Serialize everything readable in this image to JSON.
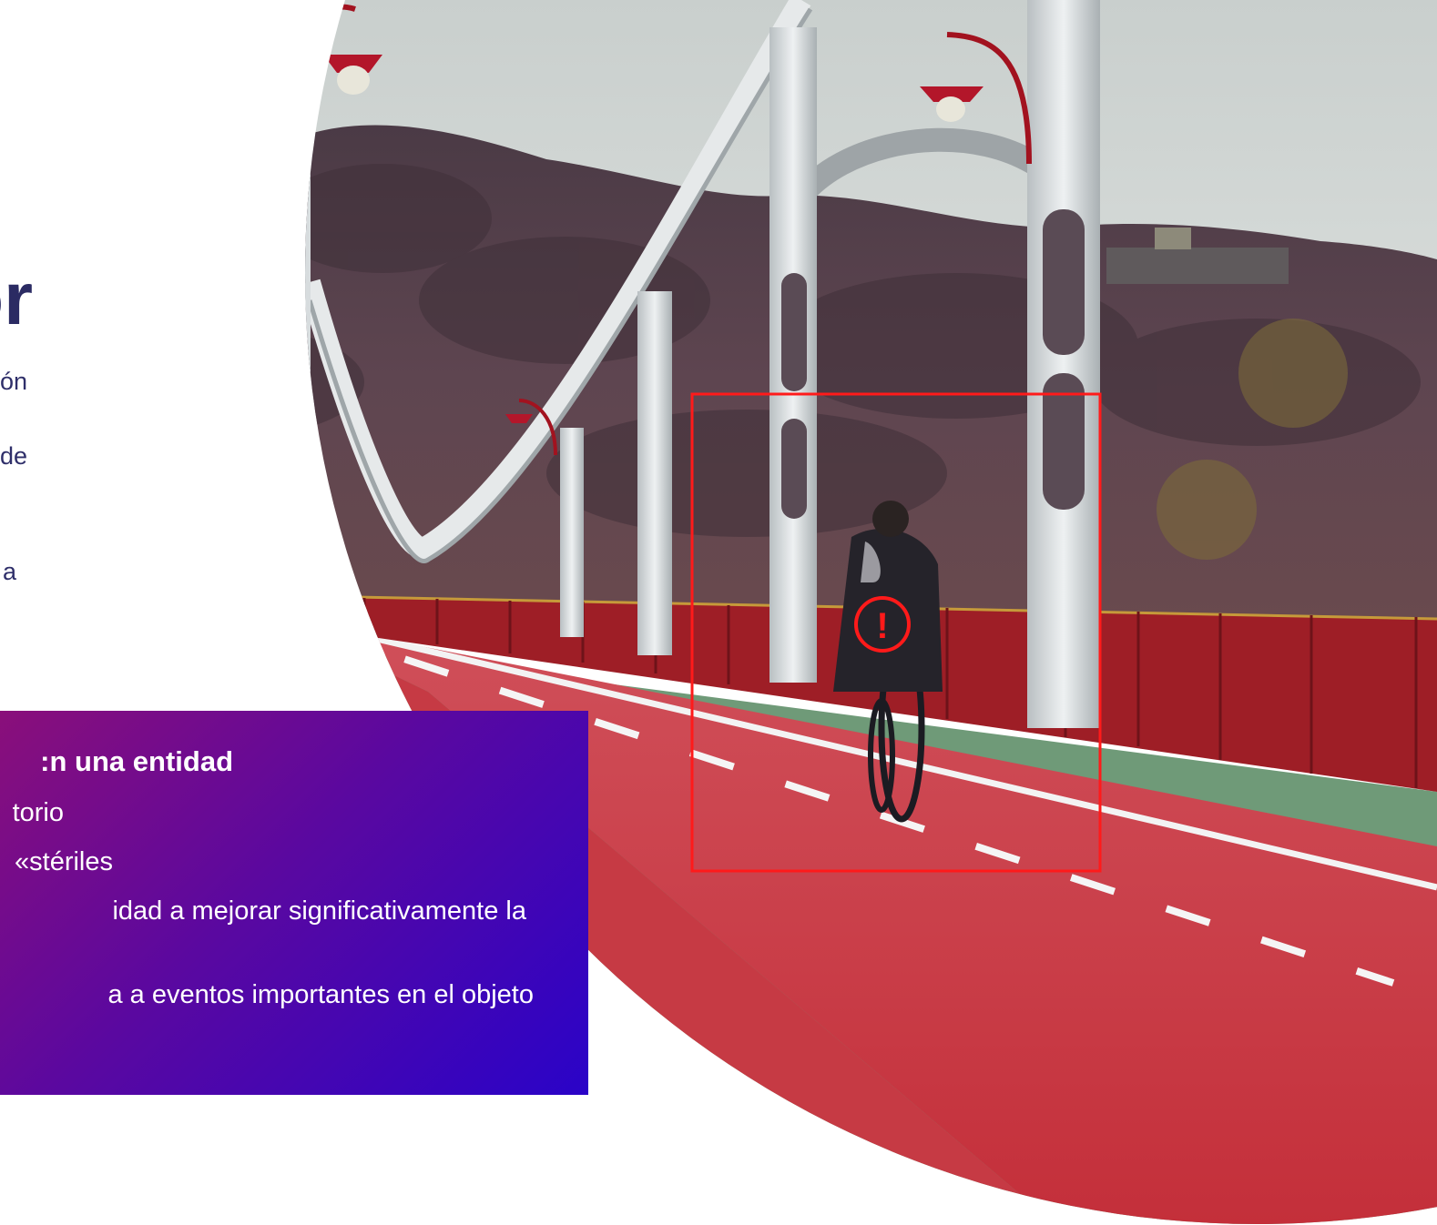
{
  "heading": "or",
  "left_fragments": [
    "ón",
    "de",
    "a"
  ],
  "gradient_box": {
    "title": "n una entidad:",
    "lines": [
      "torio",
      "stériles»",
      "idad a mejorar significativamente la",
      "a a eventos importantes en el objeto"
    ]
  },
  "detection": {
    "alert_symbol": "!",
    "box_color": "#ff1a1a"
  },
  "colors": {
    "heading": "#2b2b63",
    "box_gradient_start": "#8a0f7a",
    "box_gradient_end": "#2a03c8",
    "bike_lane": "#c8333c",
    "walkway": "#6f9a78",
    "railing": "#9e1e26"
  }
}
